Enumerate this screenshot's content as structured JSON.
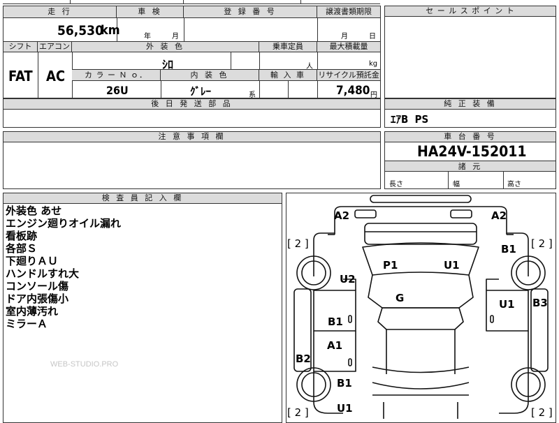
{
  "sheet": {
    "mileage": {
      "header": "走 行",
      "value": "56,530",
      "unit": "km"
    },
    "inspection": {
      "header": "車 検",
      "year_label": "年",
      "month_label": "月"
    },
    "registration_no": {
      "header": "登 録 番 号"
    },
    "transfer_deadline": {
      "header": "譲渡書類期限",
      "month_label": "月",
      "day_label": "日"
    },
    "sales_point": {
      "header": "セ ー ル ス ポ イ ン ト"
    },
    "shift": {
      "header": "シフト",
      "value": "FAT"
    },
    "aircon": {
      "header": "エアコン",
      "value": "AC"
    },
    "exterior_color": {
      "header": "外 装 色",
      "value": "ｼﾛ"
    },
    "capacity": {
      "header": "乗車定員",
      "unit": "人"
    },
    "max_load": {
      "header": "最大積載量",
      "unit": "kg"
    },
    "color_no": {
      "header": "カ ラ ー Ｎ ｏ．",
      "value": "26U"
    },
    "interior_color": {
      "header": "内 装 色",
      "value": "ｸﾞﾚｰ",
      "suffix": "系"
    },
    "import": {
      "header": "輸 入 車"
    },
    "recycle": {
      "header": "リサイクル預託金",
      "value": "7,480",
      "unit": "円"
    },
    "deferred_parts": {
      "header": "後 日 発 送 部 品"
    },
    "genuine_equipment": {
      "header": "純 正 装 備",
      "value": "ｴｱB  PS"
    },
    "notes": {
      "header": "注 意 事 項 欄"
    },
    "chassis": {
      "header": "車 台 番 号",
      "value": "HA24V-152011"
    },
    "dimensions": {
      "header": "諸 元",
      "length": "長さ",
      "width": "幅",
      "height": "高さ"
    },
    "inspector": {
      "header": "検 査 員 記 入 欄",
      "lines": [
        "外装色 あせ",
        "エンジン廻りオイル漏れ",
        "看板跡",
        "各部Ｓ",
        "下廻りＡＵ",
        "ハンドルすれ大",
        "コンソール傷",
        "ドア内張傷小",
        "室内薄汚れ",
        "ミラーＡ"
      ]
    },
    "watermark": "WEB-STUDIO.PRO"
  },
  "diagram": {
    "marks": {
      "a2_left": "A2",
      "a2_right": "A2",
      "br_fl": "[ 2 ]",
      "br_fr": "[ 2 ]",
      "br_rl": "[ 2 ]",
      "br_rr": "[ 2 ]",
      "b1_fr": "B1",
      "u2_fl": "U2",
      "p1": "P1",
      "u1_roof": "U1",
      "g": "G",
      "u1_rdoor": "U1",
      "b3": "B3",
      "b1_ldoor": "B1",
      "a1_ldoor": "A1",
      "b2": "B2",
      "b1_rl": "B1",
      "u1_rear": "U1"
    }
  }
}
